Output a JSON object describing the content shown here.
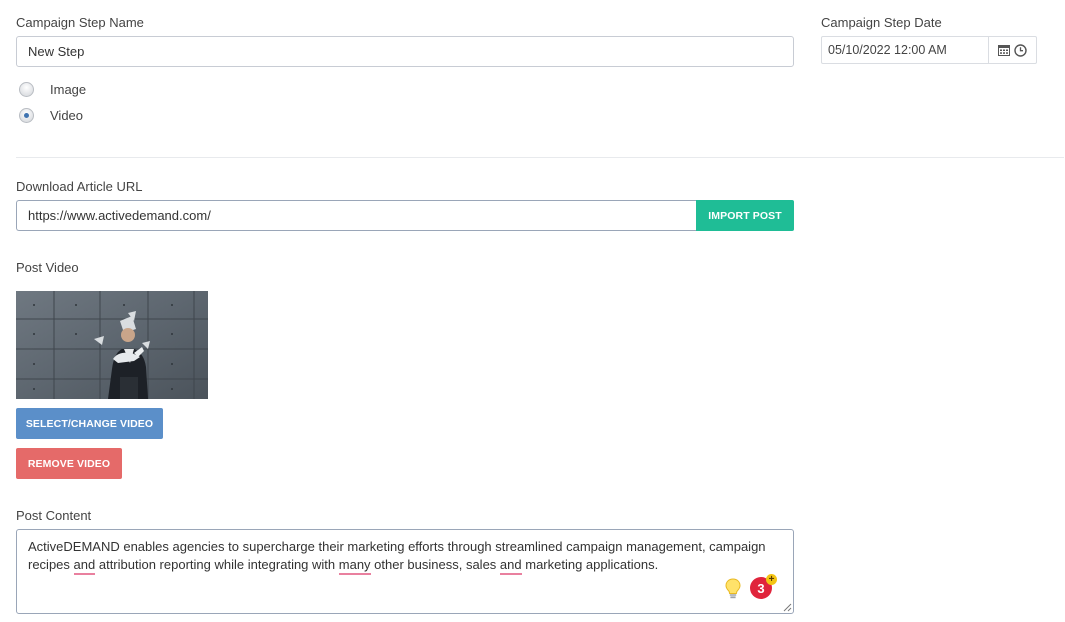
{
  "step": {
    "name_label": "Campaign Step Name",
    "name_value": "New Step",
    "date_label": "Campaign Step Date",
    "date_value": "05/10/2022 12:00 AM"
  },
  "media_type": {
    "options": [
      {
        "label": "Image",
        "checked": false
      },
      {
        "label": "Video",
        "checked": true
      }
    ]
  },
  "article": {
    "label": "Download Article URL",
    "url_value": "https://www.activedemand.com/",
    "import_label": "IMPORT POST"
  },
  "video": {
    "label": "Post Video",
    "select_label": "SELECT/CHANGE VIDEO",
    "remove_label": "REMOVE VIDEO"
  },
  "content": {
    "label": "Post Content",
    "segments": [
      {
        "text": "ActiveDEMAND enables agencies to supercharge their marketing efforts through streamlined campaign management, campaign recipes ",
        "flag": false
      },
      {
        "text": "and",
        "flag": true
      },
      {
        "text": " attribution reporting while integrating with ",
        "flag": false
      },
      {
        "text": "many",
        "flag": true
      },
      {
        "text": " other business, sales ",
        "flag": false
      },
      {
        "text": "and",
        "flag": true
      },
      {
        "text": " marketing applications.",
        "flag": false
      }
    ],
    "badge_count": "3",
    "badge_plus": "+"
  },
  "colors": {
    "import_button": "#1fbd96",
    "select_button": "#5b8fc9",
    "remove_button": "#e56a69",
    "spell_underline": "#e9809f",
    "badge": "#e0243b"
  },
  "icons": [
    "calendar-icon",
    "clock-icon",
    "lightbulb-icon",
    "grammar-badge-icon",
    "resize-handle-icon"
  ]
}
